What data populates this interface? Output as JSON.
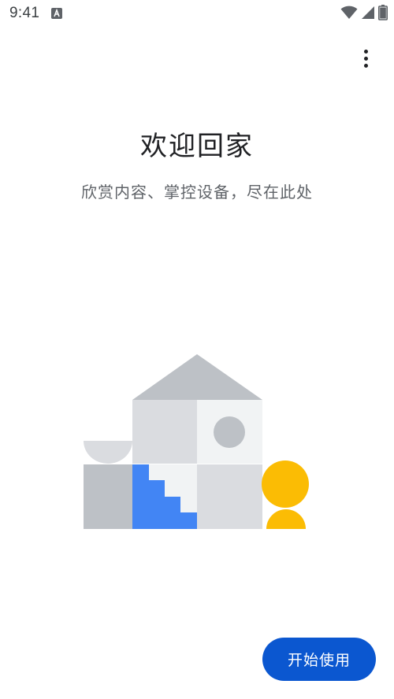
{
  "status_bar": {
    "time": "9:41",
    "notification_icon": "font-a-icon",
    "wifi_icon": "wifi-icon",
    "signal_icon": "cell-signal-icon",
    "battery_icon": "battery-icon"
  },
  "header": {
    "menu_icon": "more-vert-icon"
  },
  "welcome": {
    "title": "欢迎回家",
    "subtitle": "欣赏内容、掌控设备，尽在此处"
  },
  "illustration": {
    "icon": "home-illustration",
    "colors": {
      "roof": "#bdc1c6",
      "wall_gray": "#dadce0",
      "wall_light": "#f1f3f4",
      "block_dark": "#bdc1c6",
      "stairs_blue": "#4285f4",
      "person_yellow": "#fbbc04",
      "circle": "#bdc1c6"
    }
  },
  "footer": {
    "get_started_label": "开始使用",
    "button_color": "#0b57d0"
  }
}
